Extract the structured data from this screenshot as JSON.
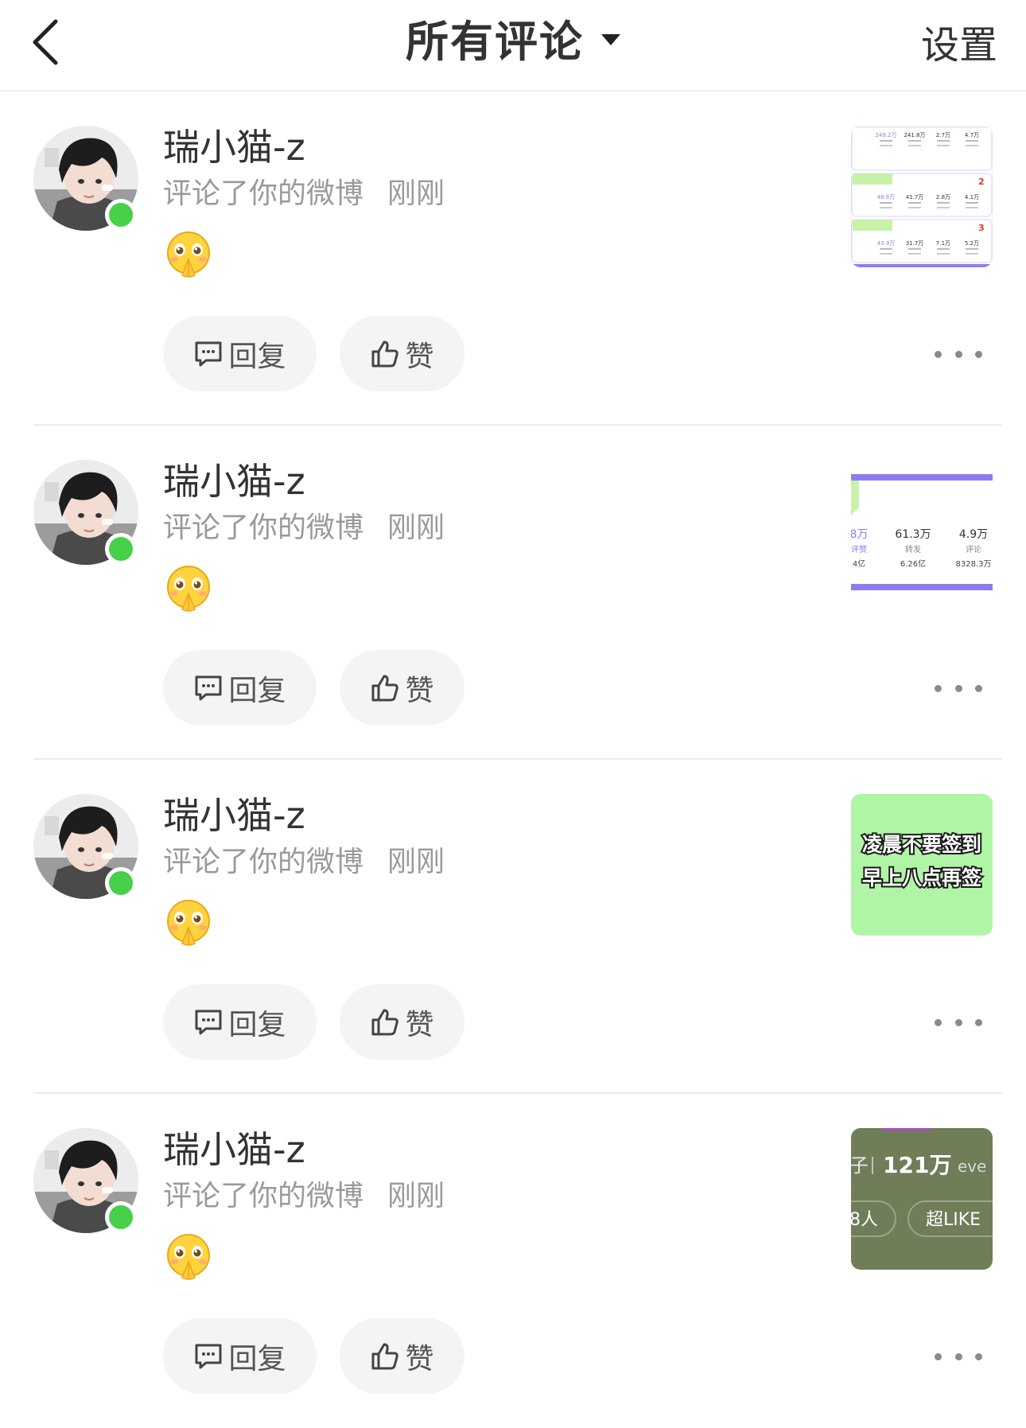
{
  "header": {
    "title": "所有评论",
    "settings_label": "设置",
    "back_icon": "chevron-left-icon",
    "dropdown_icon": "caret-down-icon"
  },
  "comments": [
    {
      "user": "瑞小猫-z",
      "action": "评论了你的微博",
      "time": "刚刚",
      "emoji": "pleading-hands-emoji",
      "reply_label": "回复",
      "like_label": "赞",
      "thumb": {
        "kind": "stats",
        "values": [
          "249.2万",
          "241.8万",
          "2.7万",
          "4.7万",
          "48.6万",
          "41.7万",
          "2.8万",
          "4.1万",
          "43.9万",
          "31.7万",
          "7.1万",
          "5.2万"
        ],
        "ranks": [
          "2",
          "3"
        ]
      }
    },
    {
      "user": "瑞小猫-z",
      "action": "评论了你的微博",
      "time": "刚刚",
      "emoji": "pleading-hands-emoji",
      "reply_label": "回复",
      "like_label": "赞",
      "thumb": {
        "kind": "stats-zoom",
        "cols": [
          {
            "value": "8万",
            "label": "评赞",
            "sub": "4亿"
          },
          {
            "value": "61.3万",
            "label": "转发",
            "sub": "6.26亿"
          },
          {
            "value": "4.9万",
            "label": "评论",
            "sub": "8328.3万"
          }
        ]
      }
    },
    {
      "user": "瑞小猫-z",
      "action": "评论了你的微博",
      "time": "刚刚",
      "emoji": "pleading-hands-emoji",
      "reply_label": "回复",
      "like_label": "赞",
      "thumb": {
        "kind": "text",
        "lines": [
          "凌晨不要签到",
          "早上八点再签"
        ],
        "bg": "#b0f5a6"
      }
    },
    {
      "user": "瑞小猫-z",
      "action": "评论了你的微博",
      "time": "刚刚",
      "emoji": "pleading-hands-emoji",
      "reply_label": "回复",
      "like_label": "赞",
      "thumb": {
        "kind": "dark",
        "top_left": "子",
        "top_main": "121万",
        "top_right": "eve",
        "bottom_left": "8人",
        "bottom_right": "超LIKE",
        "bg": "#6f7d59"
      }
    }
  ],
  "colors": {
    "online": "#47d14a",
    "pill_bg": "#f4f4f4",
    "meta_text": "#9a9a9a",
    "accent_purple": "#8d7cf0"
  }
}
